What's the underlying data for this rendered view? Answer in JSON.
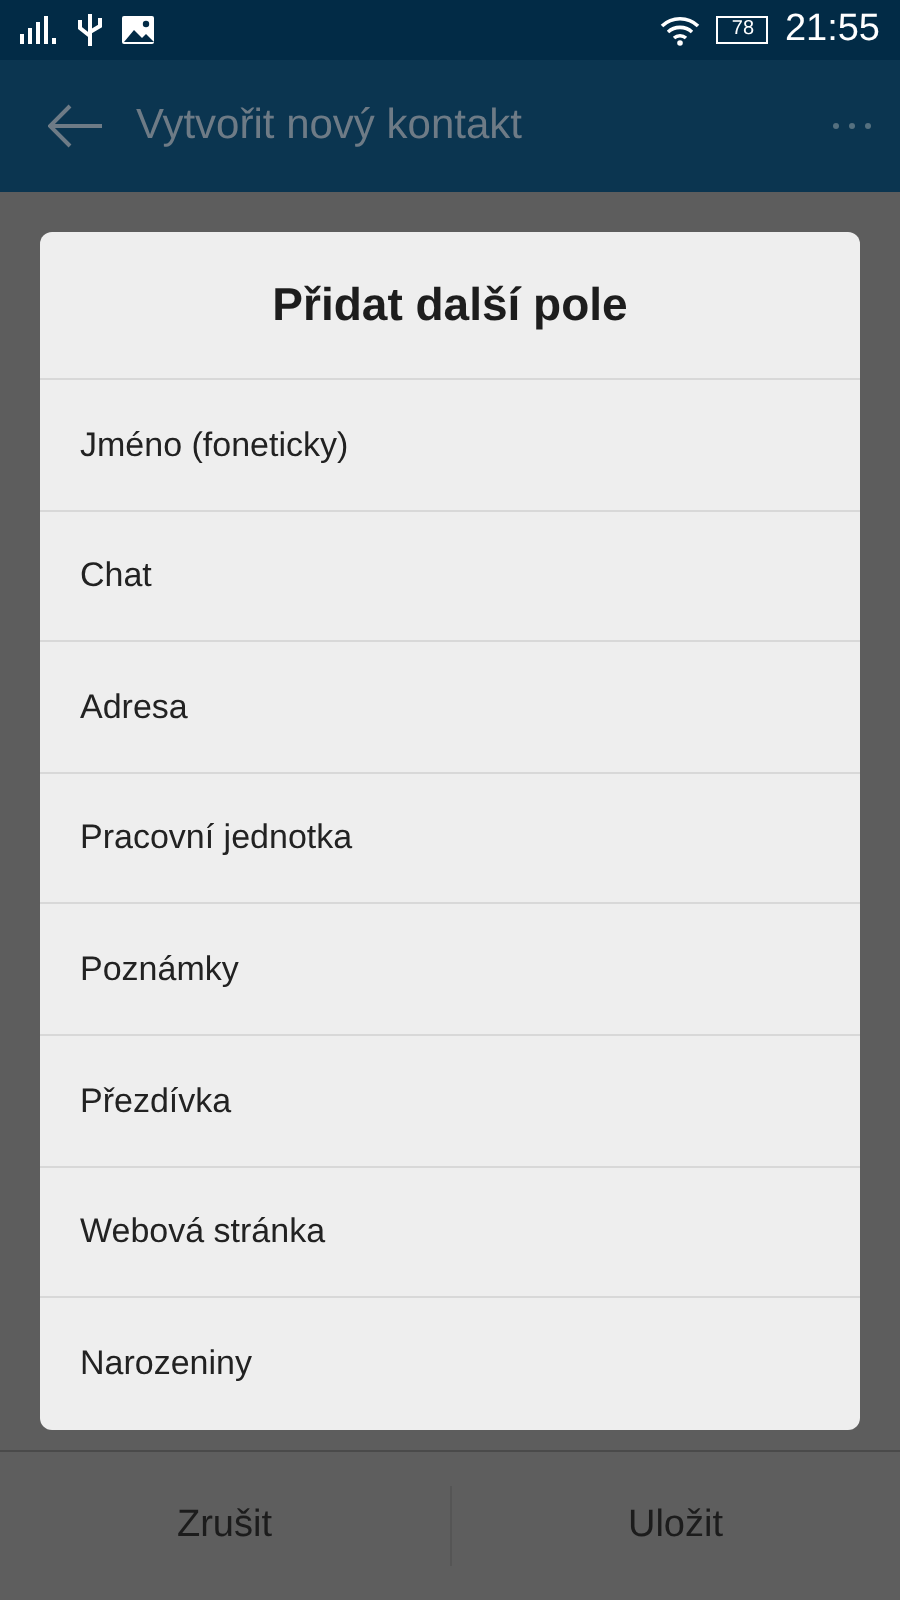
{
  "status_bar": {
    "battery": "78",
    "time": "21:55"
  },
  "app_bar": {
    "title": "Vytvořit nový kontakt"
  },
  "dialog": {
    "title": "Přidat další pole",
    "items": [
      {
        "label": "Jméno (foneticky)"
      },
      {
        "label": "Chat"
      },
      {
        "label": "Adresa"
      },
      {
        "label": "Pracovní jednotka"
      },
      {
        "label": "Poznámky"
      },
      {
        "label": "Přezdívka"
      },
      {
        "label": "Webová stránka"
      },
      {
        "label": "Narozeniny"
      }
    ]
  },
  "bottom_bar": {
    "buttons": [
      "Zrušit",
      "Uložit"
    ]
  }
}
